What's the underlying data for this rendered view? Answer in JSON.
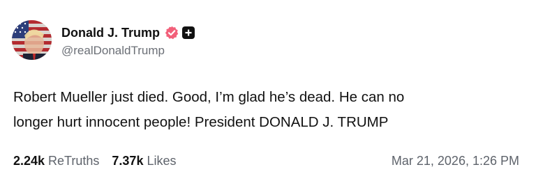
{
  "author": {
    "display_name": "Donald J. Trump",
    "handle": "@realDonaldTrump"
  },
  "icons": {
    "avatar": "profile-photo-flag-portrait",
    "verified": "verified-badge-icon",
    "plus": "plus-badge-icon"
  },
  "colors": {
    "verified": "#f2607a",
    "text": "#111111",
    "muted": "#5e636b"
  },
  "post": {
    "text_line1": "Robert Mueller just died. Good, I’m glad he’s dead. He can no",
    "text_line2": "longer hurt innocent people! President DONALD J. TRUMP"
  },
  "stats": {
    "retruths_count": "2.24k",
    "retruths_label": "ReTruths",
    "likes_count": "7.37k",
    "likes_label": "Likes"
  },
  "timestamp": "Mar 21, 2026, 1:26 PM"
}
